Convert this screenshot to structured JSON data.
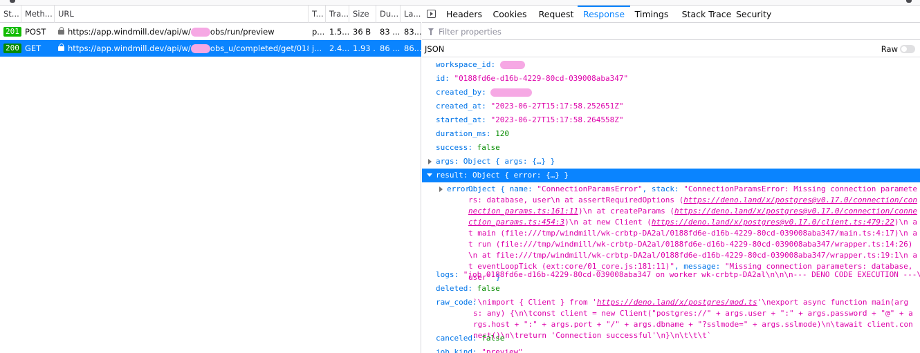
{
  "colors": {
    "accent": "#0a84ff",
    "status_ok": "#12bc00",
    "string": "#dd00a9",
    "key": "#0074e8"
  },
  "table": {
    "columns": [
      "St...",
      "Meth...",
      "URL",
      "T...",
      "Tra...",
      "Size",
      "Du...",
      "La..."
    ],
    "rows": [
      {
        "status": "201",
        "method": "POST",
        "url_prefix": "https://app.windmill.dev/api/w/",
        "url_suffix": "obs/run/preview",
        "type": "p...",
        "transferred": "1.5...",
        "size": "36 B",
        "duration": "83 ...",
        "latency": "83..."
      },
      {
        "status": "200",
        "method": "GET",
        "url_prefix": "https://app.windmill.dev/api/w/",
        "url_suffix": "obs_u/completed/get/0188f...",
        "type": "j...",
        "transferred": "2.4...",
        "size": "1.93 ...",
        "duration": "86 ...",
        "latency": "86..."
      }
    ]
  },
  "tabs": [
    "Headers",
    "Cookies",
    "Request",
    "Response",
    "Timings",
    "Stack Trace",
    "Security"
  ],
  "filter": {
    "placeholder": "Filter properties"
  },
  "json_bar": {
    "label": "JSON",
    "raw_label": "Raw"
  },
  "response": {
    "workspace_id_key": "workspace_id:",
    "id_key": "id:",
    "id_val": "\"0188fd6e-d16b-4229-80cd-039008aba347\"",
    "created_by_key": "created_by:",
    "created_at_key": "created_at:",
    "created_at_val": "\"2023-06-27T15:17:58.252651Z\"",
    "started_at_key": "started_at:",
    "started_at_val": "\"2023-06-27T15:17:58.264558Z\"",
    "duration_key": "duration_ms:",
    "duration_val": "120",
    "success_key": "success:",
    "success_val": "false",
    "args_key": "args:",
    "args_val": "Object { args: {…} }",
    "result_key": "result:",
    "result_val": "Object { error: {…} }",
    "error_key": "error:",
    "error_p1": "Object { name: ",
    "error_name": "\"ConnectionParamsError\"",
    "error_p2": ", stack: ",
    "error_stack_a": "\"ConnectionParamsError: Missing connection parameters: database, user\\n at assertRequiredOptions (",
    "error_url1": "https://deno.land/x/postgres@v0.17.0/connection/connection_params.ts:161:11",
    "error_stack_b": ")\\n at createParams (",
    "error_url2": "https://deno.land/x/postgres@v0.17.0/connection/connection_params.ts:454:3",
    "error_stack_c": ")\\n at new Client (",
    "error_url3": "https://deno.land/x/postgres@v0.17.0/client.ts:479:22",
    "error_stack_d": ")\\n at main (file:///tmp/windmill/wk-crbtp-DA2al/0188fd6e-d16b-4229-80cd-039008aba347/main.ts:4:17)\\n at run (file:///tmp/windmill/wk-crbtp-DA2al/0188fd6e-d16b-4229-80cd-039008aba347/wrapper.ts:14:26)\\n at file:///tmp/windmill/wk-crbtp-DA2al/0188fd6e-d16b-4229-80cd-039008aba347/wrapper.ts:19:1\\n at eventLoopTick (ext:core/01_core.js:181:11)\"",
    "error_p3": ", message: ",
    "error_message": "\"Missing connection parameters: database, user\"",
    "error_p4": " }",
    "logs_key": "logs:",
    "logs_val": "\"job 0188fd6e-d16b-4229-80cd-039008aba347 on worker wk-crbtp-DA2al\\n\\n\\n--- DENO CODE EXECUTION ---\\n\"",
    "deleted_key": "deleted:",
    "deleted_val": "false",
    "raw_code_key": "raw_code:",
    "raw_code_a": "`\\nimport { Client } from '",
    "raw_code_url": "https://deno.land/x/postgres/mod.ts",
    "raw_code_b": "'\\nexport async function main(args: any) {\\n\\tconst client = new Client(\"postgres://\" + args.user + \":\" + args.password + \"@\" + args.host + \":\" + args.port + \"/\" + args.dbname + \"?sslmode=\" + args.sslmode)\\n\\tawait client.connect()\\n\\treturn 'Connection successful'\\n}\\n\\t\\t\\t`",
    "canceled_key": "canceled:",
    "canceled_val": "false",
    "job_kind_key": "job_kind:",
    "job_kind_val": "\"preview\""
  }
}
